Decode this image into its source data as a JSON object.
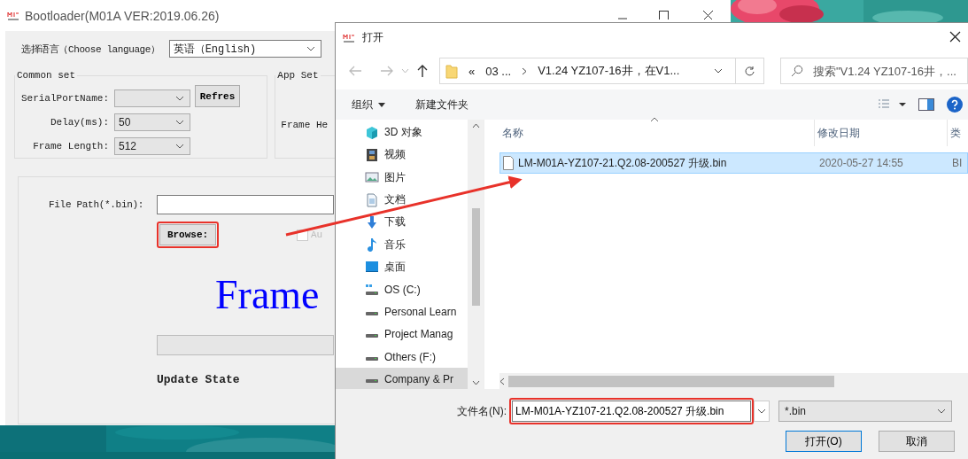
{
  "bootloader": {
    "title": "Bootloader(M01A VER:2019.06.26)",
    "language": {
      "label": "选择语言（Choose language）",
      "value": "英语（English)"
    },
    "common_set": {
      "title": "Common set",
      "serial_port": {
        "label": "SerialPortName:"
      },
      "refresh_button": "Refres",
      "delay": {
        "label": "Delay(ms):",
        "value": "50"
      },
      "frame_length": {
        "label": "Frame Length:",
        "value": "512"
      }
    },
    "app_set": {
      "title": "App Set",
      "frame_header_label": "Frame He"
    },
    "file_path": {
      "label": "File Path(*.bin):"
    },
    "browse_button": "Browse:",
    "auto_checkbox": {
      "label": "Au",
      "checked": false
    },
    "frame_label": "Frame",
    "progress": {
      "level": 0
    },
    "update_state": "Update State"
  },
  "dialog": {
    "title": "打开",
    "breadcrumbs": [
      "«",
      "03 ...",
      "V1.24 YZ107-16井，在V1..."
    ],
    "search": {
      "placeholder": "搜索\"V1.24 YZ107-16井，..."
    },
    "toolbar": {
      "organize": "组织",
      "new_folder": "新建文件夹"
    },
    "nav_items": [
      {
        "label": "3D 对象",
        "kind": "objects",
        "selected": false
      },
      {
        "label": "视频",
        "kind": "video",
        "selected": false
      },
      {
        "label": "图片",
        "kind": "pictures",
        "selected": false
      },
      {
        "label": "文档",
        "kind": "documents",
        "selected": false
      },
      {
        "label": "下载",
        "kind": "downloads",
        "selected": false
      },
      {
        "label": "音乐",
        "kind": "music",
        "selected": false
      },
      {
        "label": "桌面",
        "kind": "desktop",
        "selected": false
      },
      {
        "label": "OS (C:)",
        "kind": "system-drive",
        "selected": false
      },
      {
        "label": "Personal Learn",
        "kind": "drive",
        "selected": false
      },
      {
        "label": "Project Manag",
        "kind": "drive",
        "selected": false
      },
      {
        "label": "Others (F:)",
        "kind": "drive",
        "selected": false
      },
      {
        "label": "Company & Pr",
        "kind": "drive",
        "selected": true
      }
    ],
    "columns": [
      "名称",
      "修改日期",
      "类"
    ],
    "files": [
      {
        "name": "LM-M01A-YZ107-21.Q2.08-200527 升级.bin",
        "modified": "2020-05-27 14:55",
        "type": "BI",
        "selected": true
      }
    ],
    "filename": {
      "label": "文件名(N):",
      "value": "LM-M01A-YZ107-21.Q2.08-200527 升级.bin"
    },
    "filter": "*.bin",
    "buttons": [
      "打开(O)",
      "取消"
    ]
  }
}
